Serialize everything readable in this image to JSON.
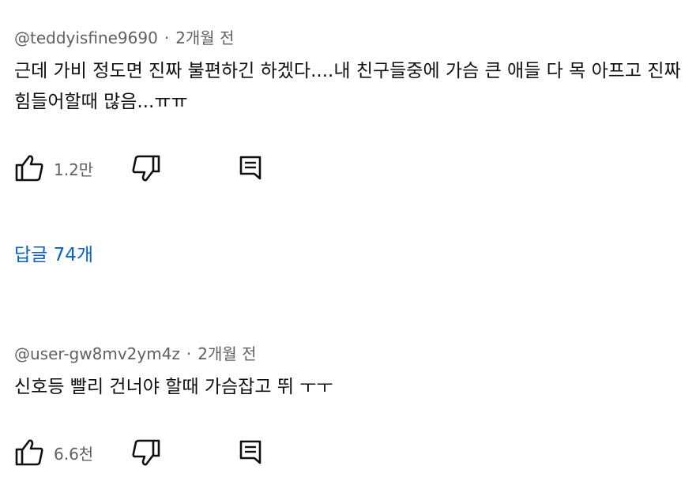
{
  "comments": [
    {
      "author": "@teddyisfine9690",
      "separator": "·",
      "time": "2개월 전",
      "text": "근데 가비 정도면 진짜 불편하긴 하겠다....내 친구들중에 가슴 큰 애들 다 목 아프고 진짜 힘들어할때 많음...ㅠㅠ",
      "likes": "1.2만",
      "replies_label": "답글 74개"
    },
    {
      "author": "@user-gw8mv2ym4z",
      "separator": "·",
      "time": "2개월 전",
      "text": "신호등 빨리 건너야 할때 가슴잡고 뛰 ㅜㅜ",
      "likes": "6.6천"
    }
  ],
  "icons": {
    "like": "thumbs-up-icon",
    "dislike": "thumbs-down-icon",
    "reply": "comment-reply-icon"
  },
  "colors": {
    "text": "#0f0f0f",
    "meta": "#606060",
    "link": "#065fd4"
  }
}
